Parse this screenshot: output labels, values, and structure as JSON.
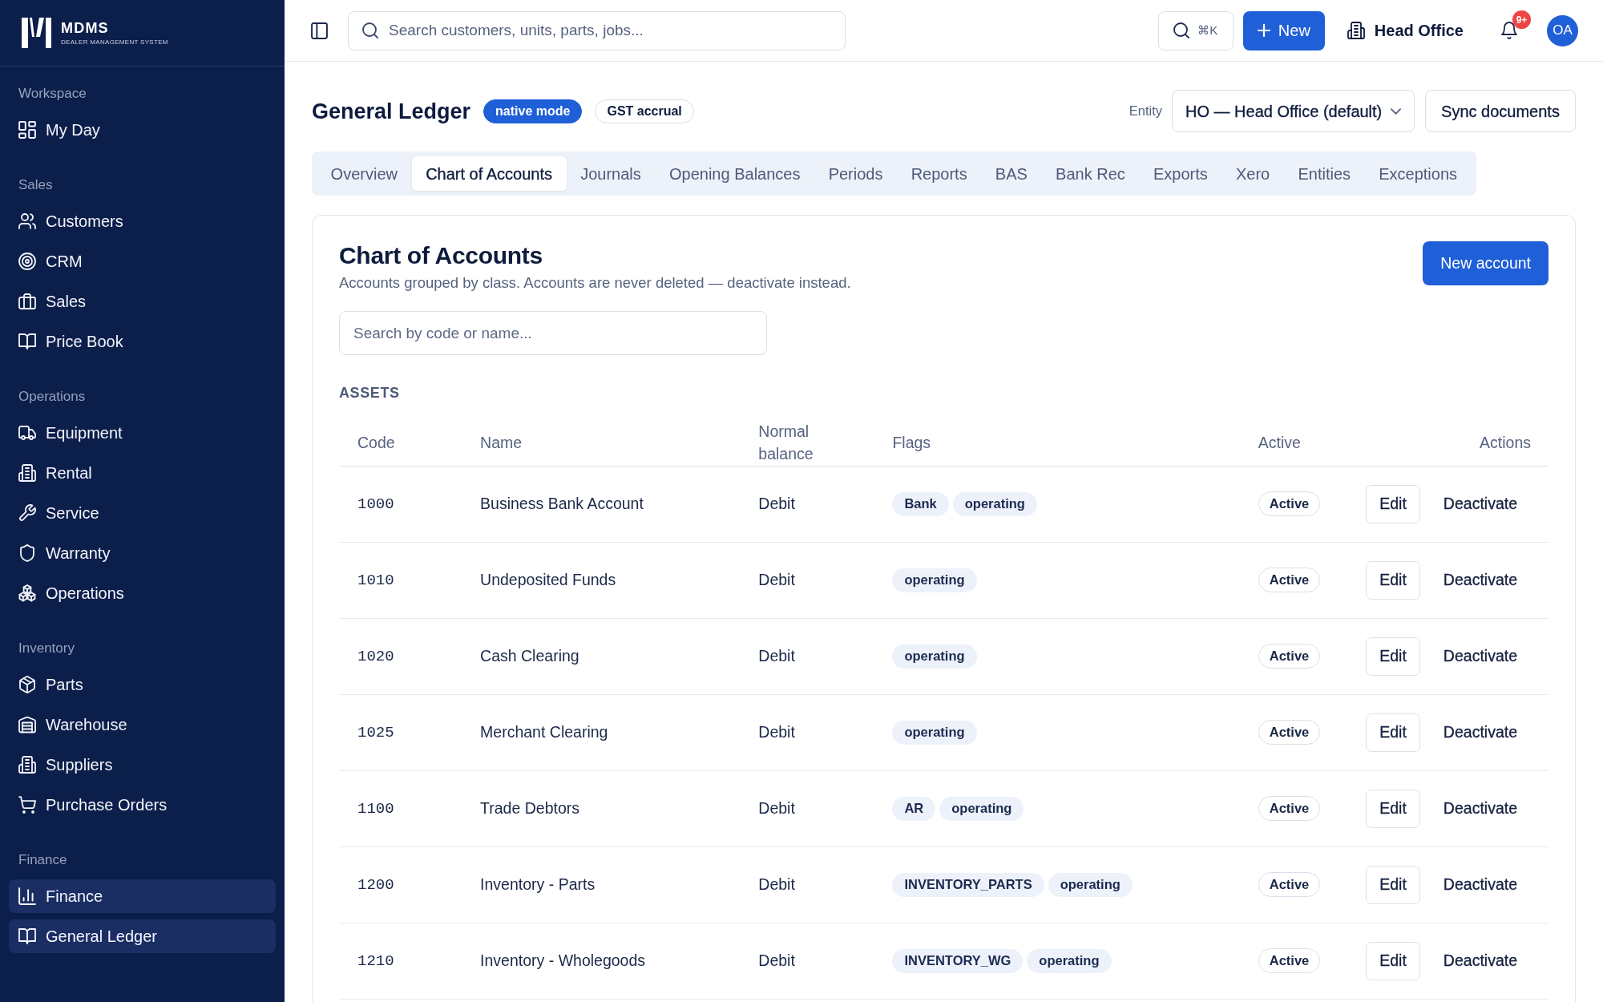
{
  "sidebar": {
    "brand": {
      "name": "MDMS",
      "tagline": "DEALER MANAGEMENT SYSTEM"
    },
    "sections": [
      {
        "label": "Workspace",
        "items": [
          {
            "label": "My Day",
            "selected": false
          }
        ]
      },
      {
        "label": "Sales",
        "items": [
          {
            "label": "Customers",
            "selected": false
          },
          {
            "label": "CRM",
            "selected": false
          },
          {
            "label": "Sales",
            "selected": false
          },
          {
            "label": "Price Book",
            "selected": false
          }
        ]
      },
      {
        "label": "Operations",
        "items": [
          {
            "label": "Equipment",
            "selected": false
          },
          {
            "label": "Rental",
            "selected": false
          },
          {
            "label": "Service",
            "selected": false
          },
          {
            "label": "Warranty",
            "selected": false
          },
          {
            "label": "Operations",
            "selected": false
          }
        ]
      },
      {
        "label": "Inventory",
        "items": [
          {
            "label": "Parts",
            "selected": false
          },
          {
            "label": "Warehouse",
            "selected": false
          },
          {
            "label": "Suppliers",
            "selected": false
          },
          {
            "label": "Purchase Orders",
            "selected": false
          }
        ]
      },
      {
        "label": "Finance",
        "items": [
          {
            "label": "Finance",
            "selected": true
          },
          {
            "label": "General Ledger",
            "selected": true
          }
        ]
      }
    ]
  },
  "topbar": {
    "search": {
      "placeholder": "Search customers, units, parts, jobs..."
    },
    "shortcut": "⌘K",
    "new_button": "New",
    "location": "Head Office",
    "notifications_badge": "9+",
    "avatar": "OA"
  },
  "header": {
    "title": "General Ledger",
    "badges": [
      {
        "label": "native mode",
        "kind": "filled"
      },
      {
        "label": "GST accrual",
        "kind": "outline"
      }
    ],
    "entity_label": "Entity",
    "entity_value": "HO — Head Office (default)",
    "sync_button": "Sync documents"
  },
  "tabs": [
    {
      "label": "Overview",
      "selected": false
    },
    {
      "label": "Chart of Accounts",
      "selected": true
    },
    {
      "label": "Journals",
      "selected": false
    },
    {
      "label": "Opening Balances",
      "selected": false
    },
    {
      "label": "Periods",
      "selected": false
    },
    {
      "label": "Reports",
      "selected": false
    },
    {
      "label": "BAS",
      "selected": false
    },
    {
      "label": "Bank Rec",
      "selected": false
    },
    {
      "label": "Exports",
      "selected": false
    },
    {
      "label": "Xero",
      "selected": false
    },
    {
      "label": "Entities",
      "selected": false
    },
    {
      "label": "Exceptions",
      "selected": false
    }
  ],
  "accounts": {
    "title": "Chart of Accounts",
    "subtitle": "Accounts grouped by class. Accounts are never deleted — deactivate instead.",
    "new_button": "New account",
    "search": {
      "placeholder": "Search by code or name..."
    },
    "group": "ASSETS",
    "columns": [
      "Code",
      "Name",
      "Normal balance",
      "Flags",
      "Active",
      "Actions"
    ],
    "rows": [
      {
        "code": "1000",
        "name": "Business Bank Account",
        "normal_balance": "Debit",
        "flags": [
          "Bank",
          "operating"
        ],
        "active": "Active",
        "actions": [
          {
            "label": "Edit",
            "kind": "outline"
          },
          {
            "label": "Deactivate",
            "kind": "plain"
          }
        ]
      },
      {
        "code": "1010",
        "name": "Undeposited Funds",
        "normal_balance": "Debit",
        "flags": [
          "operating"
        ],
        "active": "Active",
        "actions": [
          {
            "label": "Edit",
            "kind": "outline"
          },
          {
            "label": "Deactivate",
            "kind": "plain"
          }
        ]
      },
      {
        "code": "1020",
        "name": "Cash Clearing",
        "normal_balance": "Debit",
        "flags": [
          "operating"
        ],
        "active": "Active",
        "actions": [
          {
            "label": "Edit",
            "kind": "outline"
          },
          {
            "label": "Deactivate",
            "kind": "plain"
          }
        ]
      },
      {
        "code": "1025",
        "name": "Merchant Clearing",
        "normal_balance": "Debit",
        "flags": [
          "operating"
        ],
        "active": "Active",
        "actions": [
          {
            "label": "Edit",
            "kind": "outline"
          },
          {
            "label": "Deactivate",
            "kind": "plain"
          }
        ]
      },
      {
        "code": "1100",
        "name": "Trade Debtors",
        "normal_balance": "Debit",
        "flags": [
          "AR",
          "operating"
        ],
        "active": "Active",
        "actions": [
          {
            "label": "Edit",
            "kind": "outline"
          },
          {
            "label": "Deactivate",
            "kind": "plain"
          }
        ]
      },
      {
        "code": "1200",
        "name": "Inventory - Parts",
        "normal_balance": "Debit",
        "flags": [
          "INVENTORY_PARTS",
          "operating"
        ],
        "active": "Active",
        "actions": [
          {
            "label": "Edit",
            "kind": "outline"
          },
          {
            "label": "Deactivate",
            "kind": "plain"
          }
        ]
      },
      {
        "code": "1210",
        "name": "Inventory - Wholegoods",
        "normal_balance": "Debit",
        "flags": [
          "INVENTORY_WG",
          "operating"
        ],
        "active": "Active",
        "actions": [
          {
            "label": "Edit",
            "kind": "outline"
          },
          {
            "label": "Deactivate",
            "kind": "plain"
          }
        ]
      }
    ]
  }
}
